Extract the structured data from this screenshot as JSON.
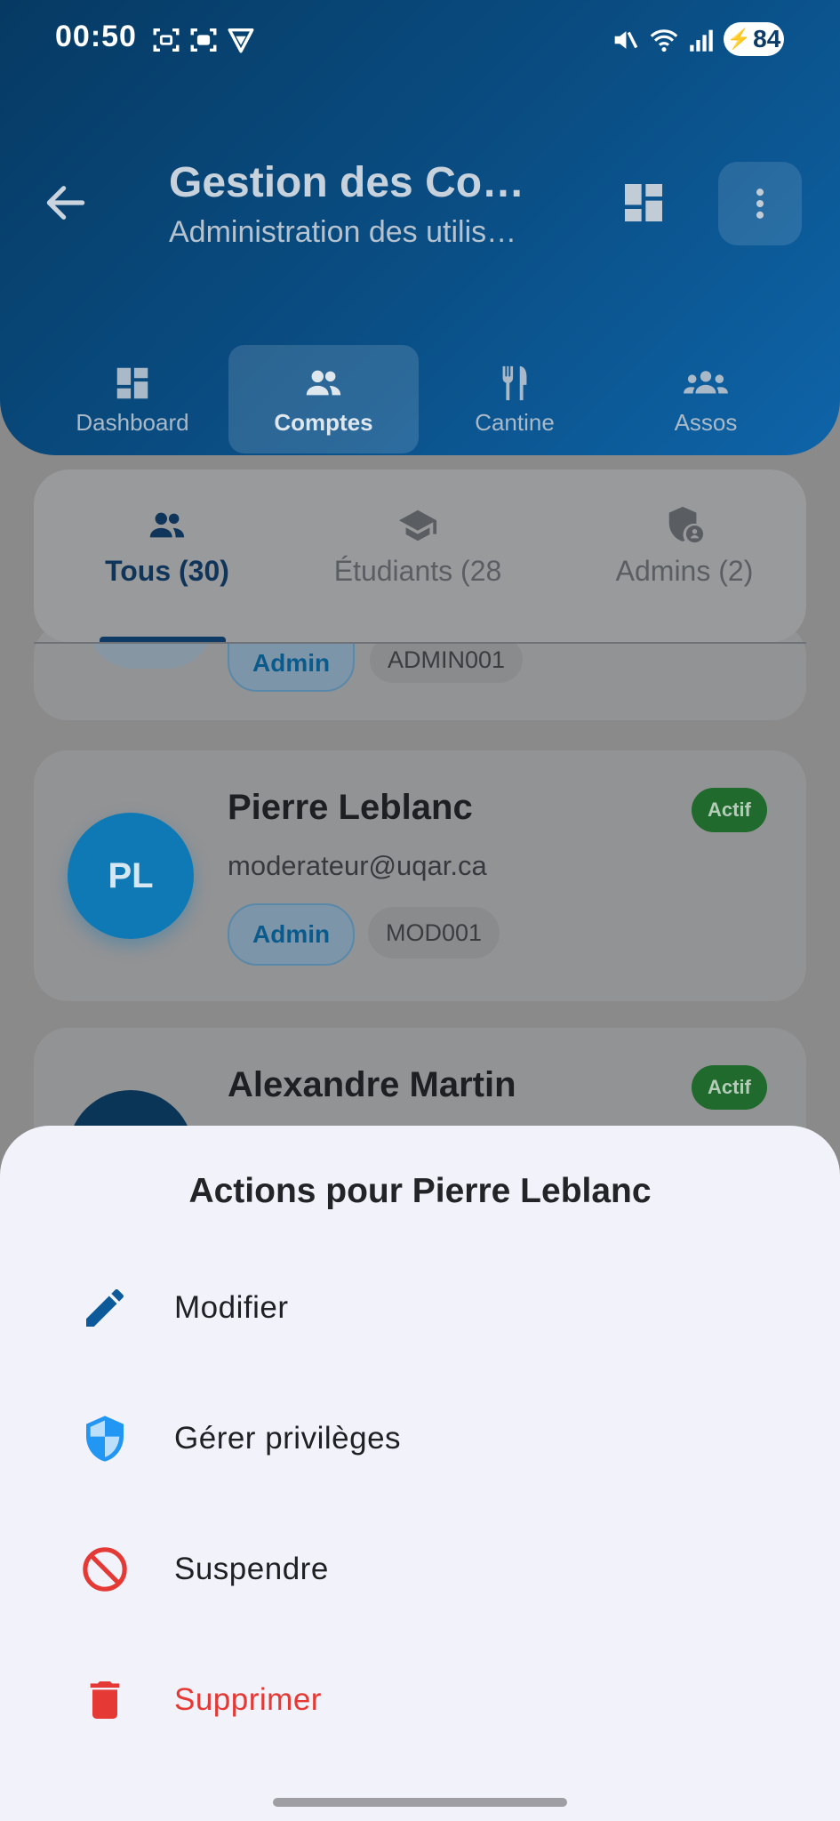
{
  "status_bar": {
    "time": "00:50",
    "battery": "84",
    "icons": [
      "screenshot-icon",
      "scan-icon",
      "vpn-icon",
      "mute-icon",
      "wifi-icon",
      "signal-icon",
      "battery-icon"
    ]
  },
  "header": {
    "title": "Gestion des Co…",
    "subtitle": "Administration des utilis…",
    "back_icon": "arrow-left-icon",
    "dashboard_icon": "dashboard-icon",
    "more_icon": "more-vertical-icon"
  },
  "nav": [
    {
      "label": "Dashboard",
      "icon": "dashboard-icon",
      "active": false
    },
    {
      "label": "Comptes",
      "icon": "people-icon",
      "active": true
    },
    {
      "label": "Cantine",
      "icon": "restaurant-icon",
      "active": false
    },
    {
      "label": "Assos",
      "icon": "groups-icon",
      "active": false
    }
  ],
  "tabs": [
    {
      "label": "Tous (30)",
      "icon": "people-icon",
      "active": true
    },
    {
      "label": "Étudiants (28",
      "icon": "school-icon",
      "active": false
    },
    {
      "label": "Admins (2)",
      "icon": "admin-shield-icon",
      "active": false
    }
  ],
  "users": [
    {
      "role": "Admin",
      "code": "ADMIN001"
    },
    {
      "initials": "PL",
      "name": "Pierre Leblanc",
      "email": "moderateur@uqar.ca",
      "role": "Admin",
      "code": "MOD001",
      "status": "Actif"
    },
    {
      "name": "Alexandre Martin",
      "status": "Actif"
    }
  ],
  "sheet": {
    "title": "Actions pour Pierre Leblanc",
    "actions": [
      {
        "label": "Modifier",
        "icon": "edit-icon"
      },
      {
        "label": "Gérer privilèges",
        "icon": "shield-icon"
      },
      {
        "label": "Suspendre",
        "icon": "block-icon"
      },
      {
        "label": "Supprimer",
        "icon": "delete-icon"
      }
    ]
  },
  "colors": {
    "header_start": "#063a63",
    "header_end": "#0e64a8",
    "sheet_bg": "#f2f3fa",
    "danger": "#e53935",
    "accent": "#0a5a8c",
    "active_green": "#1f6a2c"
  }
}
